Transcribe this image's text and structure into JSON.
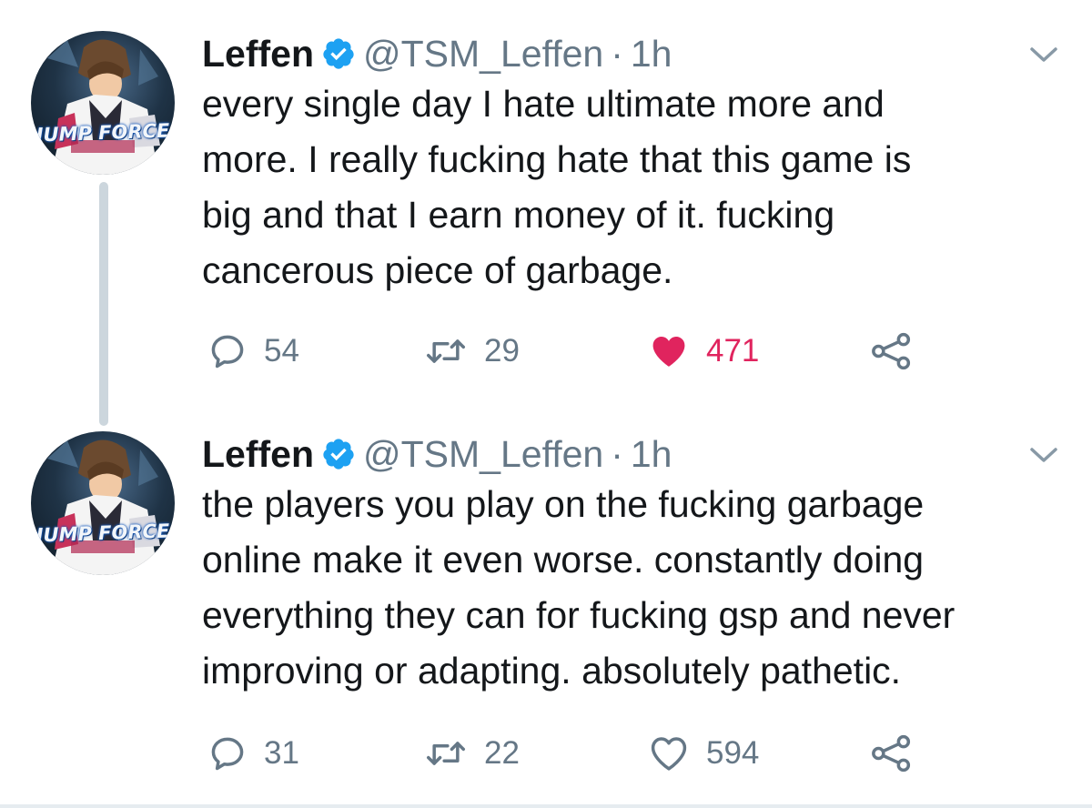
{
  "tweets": [
    {
      "author_name": "Leffen",
      "handle": "@TSM_Leffen",
      "separator": "·",
      "time": "1h",
      "avatar_text": "JUMP FORCE",
      "text_lines": [
        "every single day I hate ultimate more and",
        "more. I really fucking hate that this game is",
        "big and that I earn money of it. fucking",
        "cancerous piece of garbage."
      ],
      "replies": "54",
      "retweets": "29",
      "likes": "471",
      "liked": true
    },
    {
      "author_name": "Leffen",
      "handle": "@TSM_Leffen",
      "separator": "·",
      "time": "1h",
      "avatar_text": "JUMP FORCE",
      "text_lines": [
        "the players you play on the fucking garbage",
        "online make it even worse. constantly doing",
        "everything they can for fucking gsp and never",
        "improving or adapting. absolutely pathetic."
      ],
      "replies": "31",
      "retweets": "22",
      "likes": "594",
      "liked": false
    }
  ],
  "colors": {
    "verified": "#1da1f2",
    "like_active": "#e0245e",
    "muted": "#657786",
    "thread_line": "#ccd6dd"
  },
  "icons": [
    "verified-badge-icon",
    "chevron-down-icon",
    "reply-icon",
    "retweet-icon",
    "heart-icon",
    "share-icon"
  ]
}
